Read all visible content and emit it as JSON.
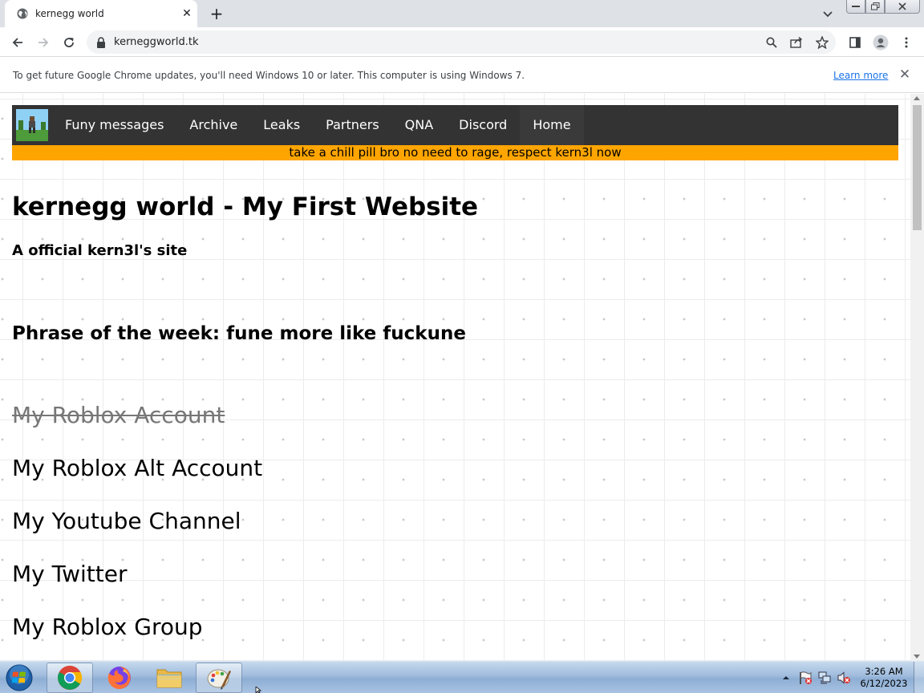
{
  "browser": {
    "tab_title": "kernegg world",
    "url": "kerneggworld.tk",
    "infobar_message": "To get future Google Chrome updates, you'll need Windows 10 or later. This computer is using Windows 7.",
    "infobar_link": "Learn more"
  },
  "site": {
    "nav_items": [
      "Funy messages",
      "Archive",
      "Leaks",
      "Partners",
      "QNA",
      "Discord",
      "Home"
    ],
    "banner": "take a chill pill bro no need to rage, respect kern3l now",
    "banner_color": "#ffa500",
    "nav_color": "#333333",
    "heading": "kernegg world - My First Website",
    "subheading": "A official kern3l's site",
    "phrase": "Phrase of the week: fune more like fuckune",
    "links": [
      {
        "label": "My Roblox Account",
        "struck": true
      },
      {
        "label": "My Roblox Alt Account",
        "struck": false
      },
      {
        "label": "My Youtube Channel",
        "struck": false
      },
      {
        "label": "My Twitter",
        "struck": false
      },
      {
        "label": "My Roblox Group",
        "struck": false
      }
    ]
  },
  "taskbar": {
    "time": "3:26 AM",
    "date": "6/12/2023",
    "apps": [
      "chrome-icon",
      "firefox-icon",
      "explorer-folder-icon",
      "paint-icon"
    ]
  }
}
